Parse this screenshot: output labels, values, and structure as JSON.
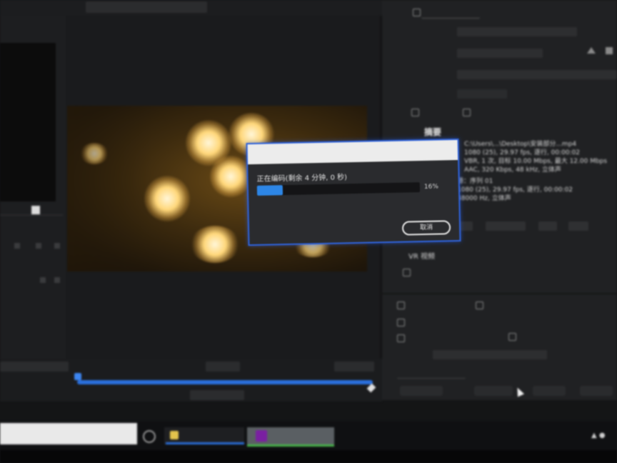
{
  "topbar": {
    "tab_label": "",
    "left_label": ""
  },
  "export_panel": {
    "summary_title": "摘要",
    "summary_lines": [
      "C:\\Users\\...\\Desktop\\安装部分...mp4",
      "1080 (25), 29.97 fps, 逐行, 00:00:02",
      "VBR, 1 次, 目标 10.00 Mbps, 最大 12.00 Mbps",
      "AAC, 320 Kbps, 48 kHz, 立体声"
    ],
    "source_lines": [
      "源：序列 01",
      "1080 (25), 29.97 fps, 逐行, 00:00:02",
      "48000 Hz, 立体声"
    ],
    "vr_label": "VR 视频"
  },
  "dialog": {
    "message": "正在编码(剩余 4 分钟, 0 秒)",
    "progress_percent": 16,
    "progress_label": "16%",
    "cancel_label": "取消"
  },
  "taskbar": {
    "search_placeholder": "",
    "app1_label": "",
    "app2_label": ""
  },
  "colors": {
    "accent": "#2f62d8",
    "progress": "#2d86e6",
    "taskbar_active": "#48b449"
  }
}
